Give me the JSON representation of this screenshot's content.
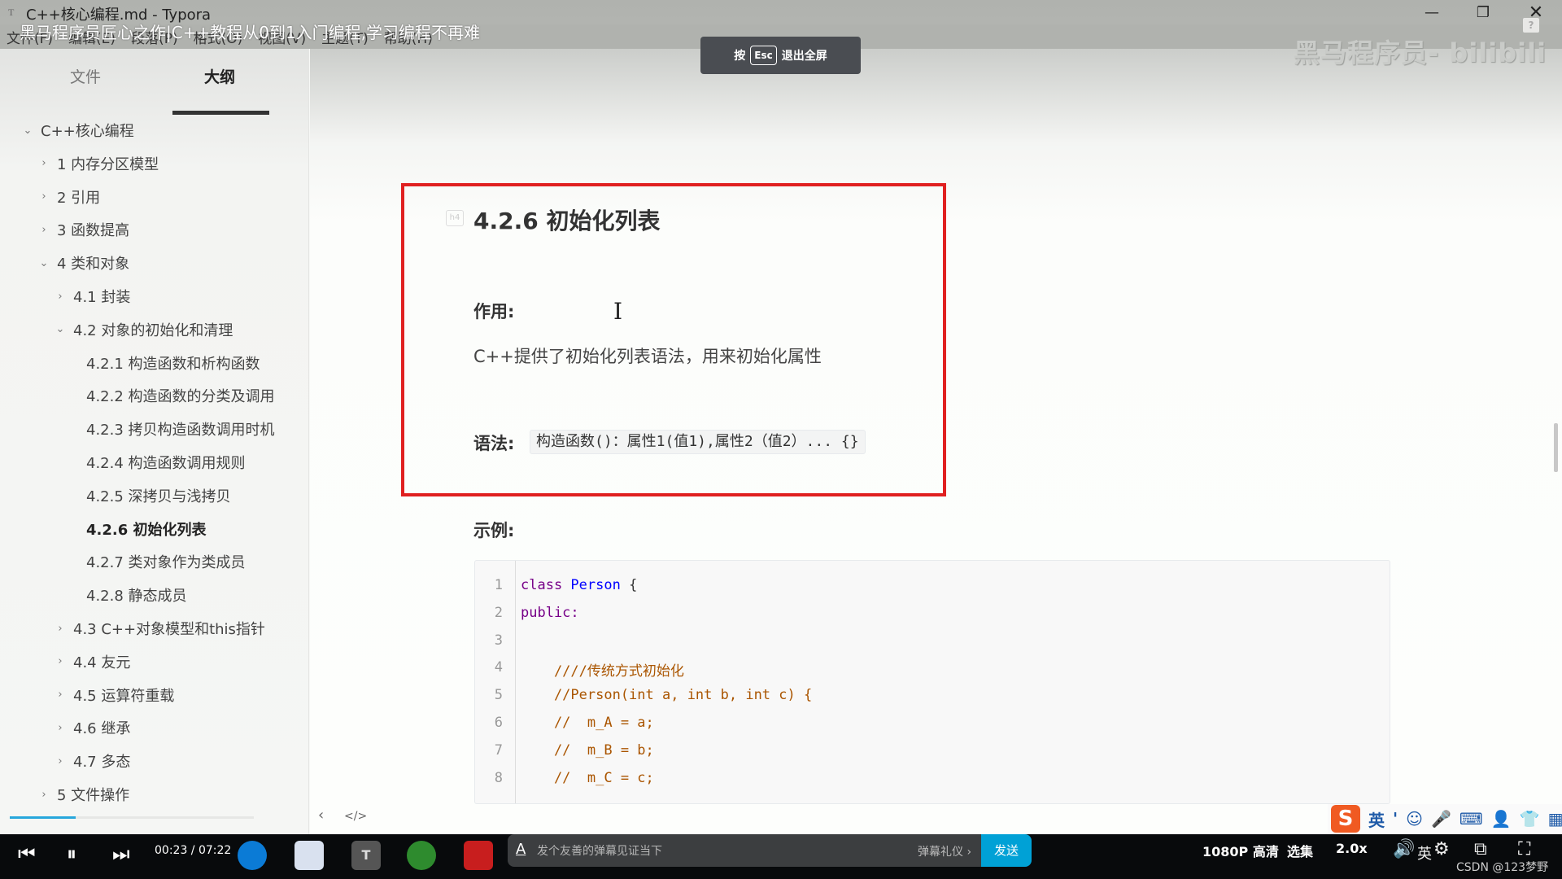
{
  "window": {
    "title": "C++核心编程.md - Typora",
    "app_icon": "T",
    "help": "?"
  },
  "menu": [
    "文件(F)",
    "编辑(E)",
    "段落(P)",
    "格式(O)",
    "视图(V)",
    "主题(T)",
    "帮助(H)"
  ],
  "video": {
    "title": "黑马程序员匠心之作|C++教程从0到1入门编程,学习编程不再难",
    "esc_hint": {
      "prefix": "按",
      "key": "Esc",
      "suffix": "退出全屏"
    },
    "watermark": "黑马程序员- bilibili"
  },
  "sidebar": {
    "tabs": [
      {
        "label": "文件"
      },
      {
        "label": "大纲"
      }
    ],
    "active_tab": "大纲",
    "outline": [
      {
        "label": "C++核心编程",
        "level": 0,
        "state": "expanded"
      },
      {
        "label": "1 内存分区模型",
        "level": 1,
        "state": "collapsed"
      },
      {
        "label": "2 引用",
        "level": 1,
        "state": "collapsed"
      },
      {
        "label": "3 函数提高",
        "level": 1,
        "state": "collapsed"
      },
      {
        "label": "4 类和对象",
        "level": 1,
        "state": "expanded"
      },
      {
        "label": "4.1 封装",
        "level": 2,
        "state": "collapsed"
      },
      {
        "label": "4.2 对象的初始化和清理",
        "level": 2,
        "state": "expanded"
      },
      {
        "label": "4.2.1 构造函数和析构函数",
        "level": 3,
        "state": "leaf"
      },
      {
        "label": "4.2.2 构造函数的分类及调用",
        "level": 3,
        "state": "leaf"
      },
      {
        "label": "4.2.3 拷贝构造函数调用时机",
        "level": 3,
        "state": "leaf"
      },
      {
        "label": "4.2.4 构造函数调用规则",
        "level": 3,
        "state": "leaf"
      },
      {
        "label": "4.2.5 深拷贝与浅拷贝",
        "level": 3,
        "state": "leaf"
      },
      {
        "label": "4.2.6 初始化列表",
        "level": 3,
        "state": "leaf",
        "active": true
      },
      {
        "label": "4.2.7 类对象作为类成员",
        "level": 3,
        "state": "leaf"
      },
      {
        "label": "4.2.8 静态成员",
        "level": 3,
        "state": "leaf"
      },
      {
        "label": "4.3 C++对象模型和this指针",
        "level": 2,
        "state": "collapsed"
      },
      {
        "label": "4.4 友元",
        "level": 2,
        "state": "collapsed"
      },
      {
        "label": "4.5 运算符重载",
        "level": 2,
        "state": "collapsed"
      },
      {
        "label": "4.6 继承",
        "level": 2,
        "state": "collapsed"
      },
      {
        "label": "4.7 多态",
        "level": 2,
        "state": "collapsed"
      },
      {
        "label": "5 文件操作",
        "level": 1,
        "state": "collapsed"
      }
    ],
    "scroll_progress": 0.27
  },
  "document": {
    "heading_tag": "h4",
    "heading": "4.2.6 初始化列表",
    "purpose_label": "作用:",
    "purpose_text": "C++提供了初始化列表语法，用来初始化属性",
    "syntax_label": "语法:",
    "syntax_code": "构造函数()：属性1(值1),属性2（值2）... {}",
    "example_label": "示例:",
    "code_lines": [
      {
        "no": "1",
        "parts": [
          {
            "t": "class ",
            "c": "kw"
          },
          {
            "t": "Person",
            "c": "def"
          },
          {
            "t": " {",
            "c": ""
          }
        ]
      },
      {
        "no": "2",
        "parts": [
          {
            "t": "public:",
            "c": "kw"
          }
        ]
      },
      {
        "no": "3",
        "parts": []
      },
      {
        "no": "4",
        "parts": [
          {
            "t": "    ////传统方式初始化",
            "c": "cm"
          }
        ]
      },
      {
        "no": "5",
        "parts": [
          {
            "t": "    //Person(int a, int b, int c) {",
            "c": "cm"
          }
        ]
      },
      {
        "no": "6",
        "parts": [
          {
            "t": "    //  m_A = a;",
            "c": "cm"
          }
        ]
      },
      {
        "no": "7",
        "parts": [
          {
            "t": "    //  m_B = b;",
            "c": "cm"
          }
        ]
      },
      {
        "no": "8",
        "parts": [
          {
            "t": "    //  m_C = c;",
            "c": "cm"
          }
        ]
      }
    ],
    "highlight_color": "#e02020"
  },
  "bottom_tools": {
    "back": "‹",
    "source": "</>"
  },
  "ime": {
    "logo": "S",
    "lang": "英",
    "punct": "'",
    "icons": [
      "☺",
      "🎤",
      "⌨",
      "👤",
      "👕",
      "▦"
    ]
  },
  "player": {
    "time": "00:23 / 07:22",
    "danmaku_placeholder": "发个友善的弹幕见证当下",
    "danmaku_etiquette": "弹幕礼仪 ›",
    "send": "发送",
    "quality": "1080P 高清",
    "episodes": "选集",
    "speed": "2.0x",
    "tray_lang": "英",
    "credit": "CSDN @123梦野"
  }
}
